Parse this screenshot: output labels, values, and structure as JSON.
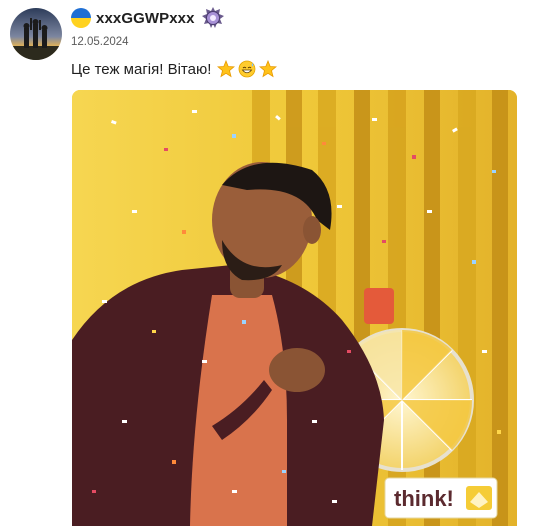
{
  "post": {
    "author": {
      "username": "xxxGGWPxxx",
      "flag_icon": "ukraine-flag-icon",
      "badge_icon": "guild-badge-icon",
      "avatar_icon": "avatar-silhouettes-sunset"
    },
    "date": "12.05.2024",
    "message": {
      "text": "Це теж магія! Вітаю!",
      "emojis": [
        "star-emoji-icon",
        "grinning-sweat-emoji-icon",
        "star-emoji-icon"
      ]
    },
    "media": {
      "type": "gif",
      "watermark": "think!"
    }
  },
  "colors": {
    "flag_blue": "#1f6fd4",
    "flag_yellow": "#ffd21f",
    "gif_background": "#f2cf3e",
    "jacket": "#4a1d22",
    "shirt": "#d9734c"
  }
}
